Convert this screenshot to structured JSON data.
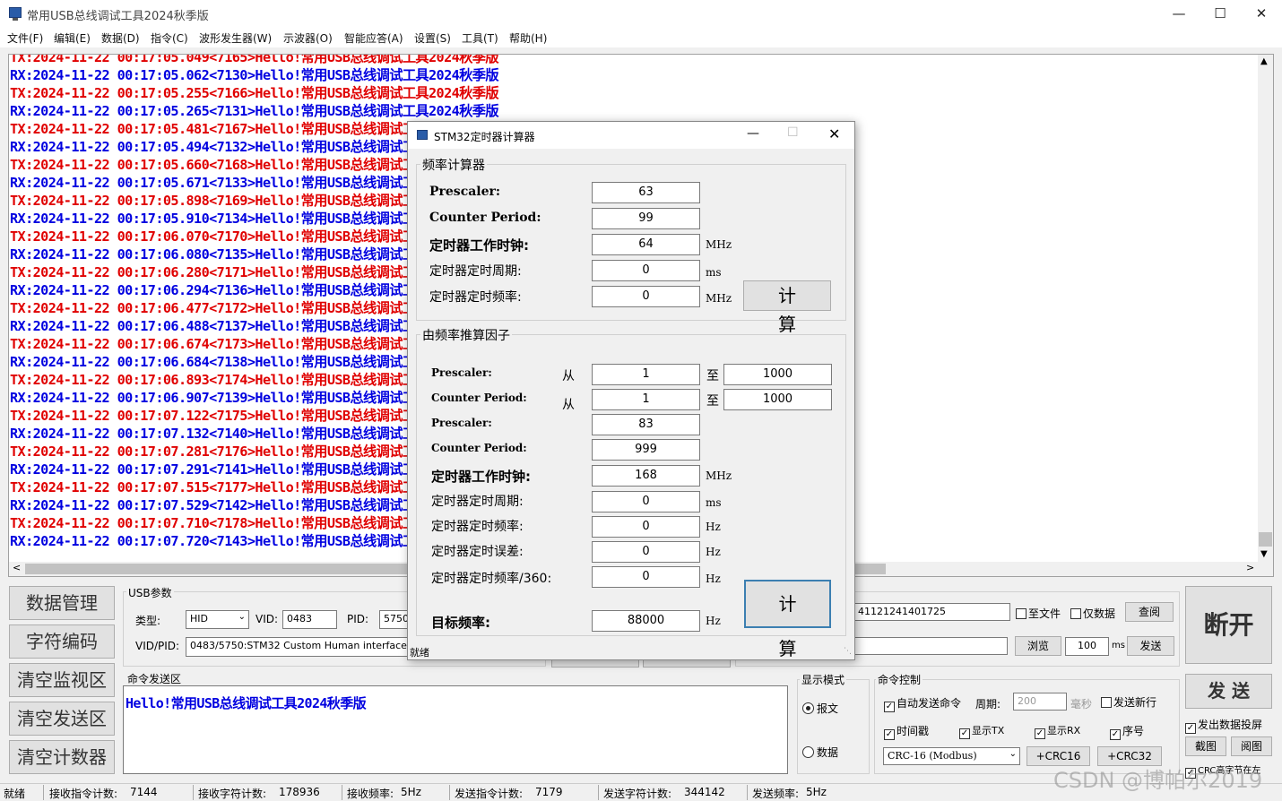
{
  "window": {
    "title": "常用USB总线调试工具2024秋季版"
  },
  "menu": [
    "文件(F)",
    "编辑(E)",
    "数据(D)",
    "指令(C)",
    "波形发生器(W)",
    "示波器(O)",
    "智能应答(A)",
    "设置(S)",
    "工具(T)",
    "帮助(H)"
  ],
  "log": [
    {
      "text": "TX:2024-11-22 00:17:05.049<7165>Hello!常用USB总线调试工具2024秋季版",
      "color": "#e00000"
    },
    {
      "text": "RX:2024-11-22 00:17:05.062<7130>Hello!常用USB总线调试工具2024秋季版",
      "color": "#0000e0"
    },
    {
      "text": "TX:2024-11-22 00:17:05.255<7166>Hello!常用USB总线调试工具2024秋季版",
      "color": "#e00000"
    },
    {
      "text": "RX:2024-11-22 00:17:05.265<7131>Hello!常用USB总线调试工具2024秋季版",
      "color": "#0000e0"
    },
    {
      "text": "TX:2024-11-22 00:17:05.481<7167>Hello!常用USB总线调试工具2024秋季版",
      "color": "#e00000"
    },
    {
      "text": "RX:2024-11-22 00:17:05.494<7132>Hello!常用USB总线调试工具2024秋季版",
      "color": "#0000e0"
    },
    {
      "text": "TX:2024-11-22 00:17:05.660<7168>Hello!常用USB总线调试工具2024秋季版",
      "color": "#e00000"
    },
    {
      "text": "RX:2024-11-22 00:17:05.671<7133>Hello!常用USB总线调试工具2024秋季版",
      "color": "#0000e0"
    },
    {
      "text": "TX:2024-11-22 00:17:05.898<7169>Hello!常用USB总线调试工具2024秋季版",
      "color": "#e00000"
    },
    {
      "text": "RX:2024-11-22 00:17:05.910<7134>Hello!常用USB总线调试工具2024秋季版",
      "color": "#0000e0"
    },
    {
      "text": "TX:2024-11-22 00:17:06.070<7170>Hello!常用USB总线调试工具2024秋季版",
      "color": "#e00000"
    },
    {
      "text": "RX:2024-11-22 00:17:06.080<7135>Hello!常用USB总线调试工具2024秋季版",
      "color": "#0000e0"
    },
    {
      "text": "TX:2024-11-22 00:17:06.280<7171>Hello!常用USB总线调试工具2024秋季版",
      "color": "#e00000"
    },
    {
      "text": "RX:2024-11-22 00:17:06.294<7136>Hello!常用USB总线调试工具2024秋季版",
      "color": "#0000e0"
    },
    {
      "text": "TX:2024-11-22 00:17:06.477<7172>Hello!常用USB总线调试工具2024秋季版",
      "color": "#e00000"
    },
    {
      "text": "RX:2024-11-22 00:17:06.488<7137>Hello!常用USB总线调试工具2024秋季版",
      "color": "#0000e0"
    },
    {
      "text": "TX:2024-11-22 00:17:06.674<7173>Hello!常用USB总线调试工具2024秋季版",
      "color": "#e00000"
    },
    {
      "text": "RX:2024-11-22 00:17:06.684<7138>Hello!常用USB总线调试工具2024秋季版",
      "color": "#0000e0"
    },
    {
      "text": "TX:2024-11-22 00:17:06.893<7174>Hello!常用USB总线调试工具2024秋季版",
      "color": "#e00000"
    },
    {
      "text": "RX:2024-11-22 00:17:06.907<7139>Hello!常用USB总线调试工具2024秋季版",
      "color": "#0000e0"
    },
    {
      "text": "TX:2024-11-22 00:17:07.122<7175>Hello!常用USB总线调试工具2024秋季版",
      "color": "#e00000"
    },
    {
      "text": "RX:2024-11-22 00:17:07.132<7140>Hello!常用USB总线调试工具2024秋季版",
      "color": "#0000e0"
    },
    {
      "text": "TX:2024-11-22 00:17:07.281<7176>Hello!常用USB总线调试工具2024秋季版",
      "color": "#e00000"
    },
    {
      "text": "RX:2024-11-22 00:17:07.291<7141>Hello!常用USB总线调试工具2024秋季版",
      "color": "#0000e0"
    },
    {
      "text": "TX:2024-11-22 00:17:07.515<7177>Hello!常用USB总线调试工具2024秋季版",
      "color": "#e00000"
    },
    {
      "text": "RX:2024-11-22 00:17:07.529<7142>Hello!常用USB总线调试工具2024秋季版",
      "color": "#0000e0"
    },
    {
      "text": "TX:2024-11-22 00:17:07.710<7178>Hello!常用USB总线调试工具2024秋季版",
      "color": "#e00000"
    },
    {
      "text": "RX:2024-11-22 00:17:07.720<7143>Hello!常用USB总线调试工具2024秋季版",
      "color": "#0000e0"
    }
  ],
  "left_buttons": [
    "数据管理",
    "字符编码",
    "清空监视区",
    "清空发送区",
    "清空计数器"
  ],
  "usb": {
    "group_label": "USB参数",
    "type_label": "类型:",
    "type_value": "HID",
    "vid_label": "VID:",
    "vid_value": "0483",
    "pid_label": "PID:",
    "pid_value": "5750",
    "vidpid_label": "VID/PID:",
    "vidpid_value": "0483/5750:STM32 Custom Human interface"
  },
  "file": {
    "path": "41121241401725",
    "to_file": "至文件",
    "data_only": "仅数据",
    "view": "查阅",
    "browse": "浏览",
    "interval": "100",
    "interval_unit": "ms",
    "send": "发送"
  },
  "connect_button": "断开",
  "cmd": {
    "group_label": "命令发送区",
    "text": "Hello!常用USB总线调试工具2024秋季版"
  },
  "display_mode": {
    "label": "显示模式",
    "message": "报文",
    "data": "数据"
  },
  "cmd_control": {
    "label": "命令控制",
    "auto_send": "自动发送命令",
    "period_label": "周期:",
    "period_value": "200",
    "period_unit": "毫秒",
    "newline": "发送新行",
    "timestamp": "时间戳",
    "show_tx": "显示TX",
    "show_rx": "显示RX",
    "seq": "序号",
    "crc_select": "CRC-16 (Modbus)",
    "crc16": "+CRC16",
    "crc32": "+CRC32"
  },
  "right": {
    "send": "发 送",
    "projection": "发出数据投屏",
    "screenshot": "截图",
    "view": "阅图",
    "crc_note": "CRC高字节在左"
  },
  "status": {
    "ready": "就绪",
    "rx_cmd_label": "接收指令计数:",
    "rx_cmd": "7144",
    "rx_char_label": "接收字符计数:",
    "rx_char": "178936",
    "rx_freq_label": "接收频率:",
    "rx_freq": "5Hz",
    "tx_cmd_label": "发送指令计数:",
    "tx_cmd": "7179",
    "tx_char_label": "发送字符计数:",
    "tx_char": "344142",
    "tx_freq_label": "发送频率:",
    "tx_freq": "5Hz"
  },
  "watermark": "CSDN @博帕尔2019",
  "dialog": {
    "title": "STM32定时器计算器",
    "freq_group": "频率计算器",
    "prescaler_label": "Prescaler:",
    "prescaler": "63",
    "period_label": "Counter Period:",
    "period": "99",
    "clock_label": "定时器工作时钟:",
    "clock": "64",
    "clock_unit": "MHz",
    "timer_period_label": "定时器定时周期:",
    "timer_period": "0",
    "timer_period_unit": "ms",
    "timer_freq_label": "定时器定时频率:",
    "timer_freq": "0",
    "timer_freq_unit": "MHz",
    "calc": "计 算",
    "factor_group": "由频率推算因子",
    "f_prescaler_label": "Prescaler:",
    "f_period_label": "Counter Period:",
    "from": "从",
    "to": "至",
    "pre_from": "1",
    "pre_to": "1000",
    "per_from": "1",
    "per_to": "1000",
    "f_prescaler2_label": "Prescaler:",
    "f_prescaler": "83",
    "f_period2_label": "Counter Period:",
    "f_period": "999",
    "f_clock_label": "定时器工作时钟:",
    "f_clock": "168",
    "f_clock_unit": "MHz",
    "f_timer_period_label": "定时器定时周期:",
    "f_timer_period": "0",
    "f_timer_period_unit": "ms",
    "f_timer_freq_label": "定时器定时频率:",
    "f_timer_freq": "0",
    "f_timer_freq_unit": "Hz",
    "f_error_label": "定时器定时误差:",
    "f_error": "0",
    "f_error_unit": "Hz",
    "f_freq360_label": "定时器定时频率/360:",
    "f_freq360": "0",
    "f_freq360_unit": "Hz",
    "target_label": "目标频率:",
    "target": "88000",
    "target_unit": "Hz",
    "calc2": "计 算",
    "status": "就绪"
  }
}
